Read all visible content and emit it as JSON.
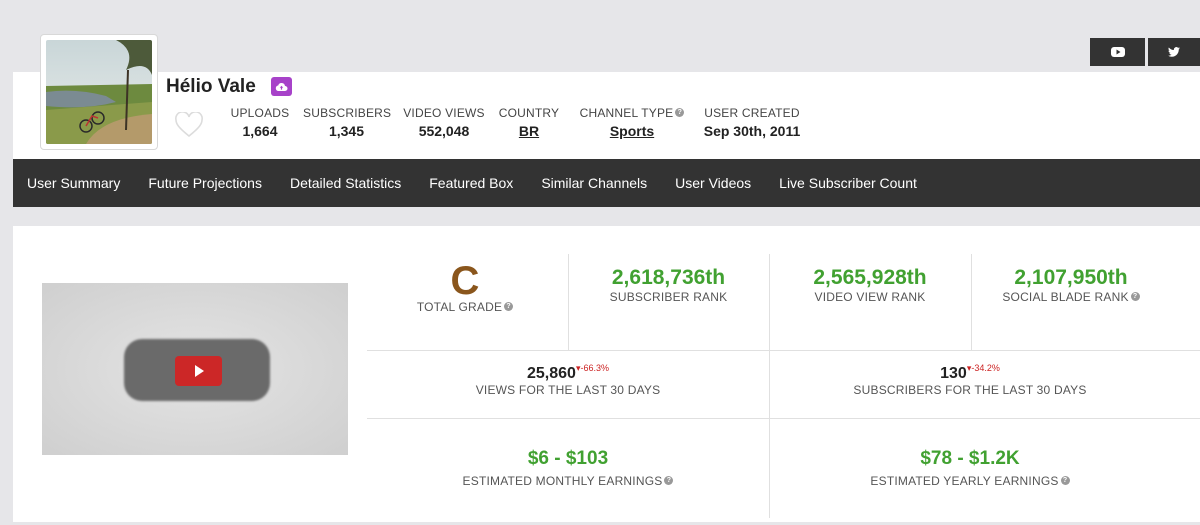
{
  "user": {
    "name": "Hélio Vale"
  },
  "social": {
    "youtube_icon": "youtube-icon",
    "twitter_icon": "twitter-icon"
  },
  "stats": {
    "uploads": {
      "label": "UPLOADS",
      "value": "1,664"
    },
    "subscribers": {
      "label": "SUBSCRIBERS",
      "value": "1,345"
    },
    "video_views": {
      "label": "VIDEO VIEWS",
      "value": "552,048"
    },
    "country": {
      "label": "COUNTRY",
      "value": "BR"
    },
    "channel_type": {
      "label": "CHANNEL TYPE",
      "value": "Sports"
    },
    "user_created": {
      "label": "USER CREATED",
      "value": "Sep 30th, 2011"
    }
  },
  "nav": [
    "User Summary",
    "Future Projections",
    "Detailed Statistics",
    "Featured Box",
    "Similar Channels",
    "User Videos",
    "Live Subscriber Count"
  ],
  "summary": {
    "grade": {
      "value": "C",
      "label": "TOTAL GRADE"
    },
    "subscriber_rank": {
      "value": "2,618,736th",
      "label": "SUBSCRIBER RANK"
    },
    "video_view_rank": {
      "value": "2,565,928th",
      "label": "VIDEO VIEW RANK"
    },
    "social_blade_rank": {
      "value": "2,107,950th",
      "label": "SOCIAL BLADE RANK"
    },
    "views_30": {
      "value": "25,860",
      "delta": "-66.3%",
      "label": "VIEWS FOR THE LAST 30 DAYS"
    },
    "subs_30": {
      "value": "130",
      "delta": "-34.2%",
      "label": "SUBSCRIBERS FOR THE LAST 30 DAYS"
    },
    "monthly": {
      "value": "$6 - $103",
      "label": "ESTIMATED MONTHLY EARNINGS"
    },
    "yearly": {
      "value": "$78 - $1.2K",
      "label": "ESTIMATED YEARLY EARNINGS"
    }
  },
  "colors": {
    "accent_green": "#41a131",
    "grade_brown": "#8a561c",
    "nav_bg": "#333333",
    "partner_purple": "#a742c9",
    "delta_red": "#cc2222"
  }
}
